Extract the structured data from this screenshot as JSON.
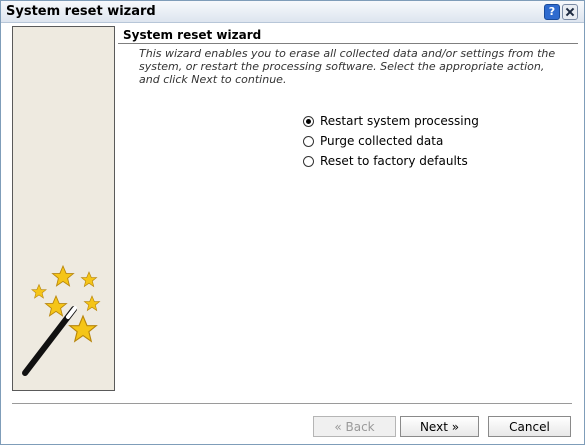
{
  "window": {
    "title": "System reset wizard",
    "help_icon": "help-icon",
    "close_icon": "close-icon"
  },
  "wizard": {
    "heading": "System reset wizard",
    "intro": "This wizard enables you to erase all collected data and/or settings from the system, or restart the processing software. Select the appropriate action, and click Next to continue.",
    "side_image": "magic-wand-with-stars"
  },
  "options": [
    {
      "label": "Restart system processing",
      "selected": true
    },
    {
      "label": "Purge collected data",
      "selected": false
    },
    {
      "label": "Reset to factory defaults",
      "selected": false
    }
  ],
  "buttons": {
    "back": "« Back",
    "next": "Next »",
    "cancel": "Cancel"
  },
  "colors": {
    "titlebar": "#dde5ef",
    "side_panel": "#eeeae0",
    "star": "#f5c518"
  }
}
